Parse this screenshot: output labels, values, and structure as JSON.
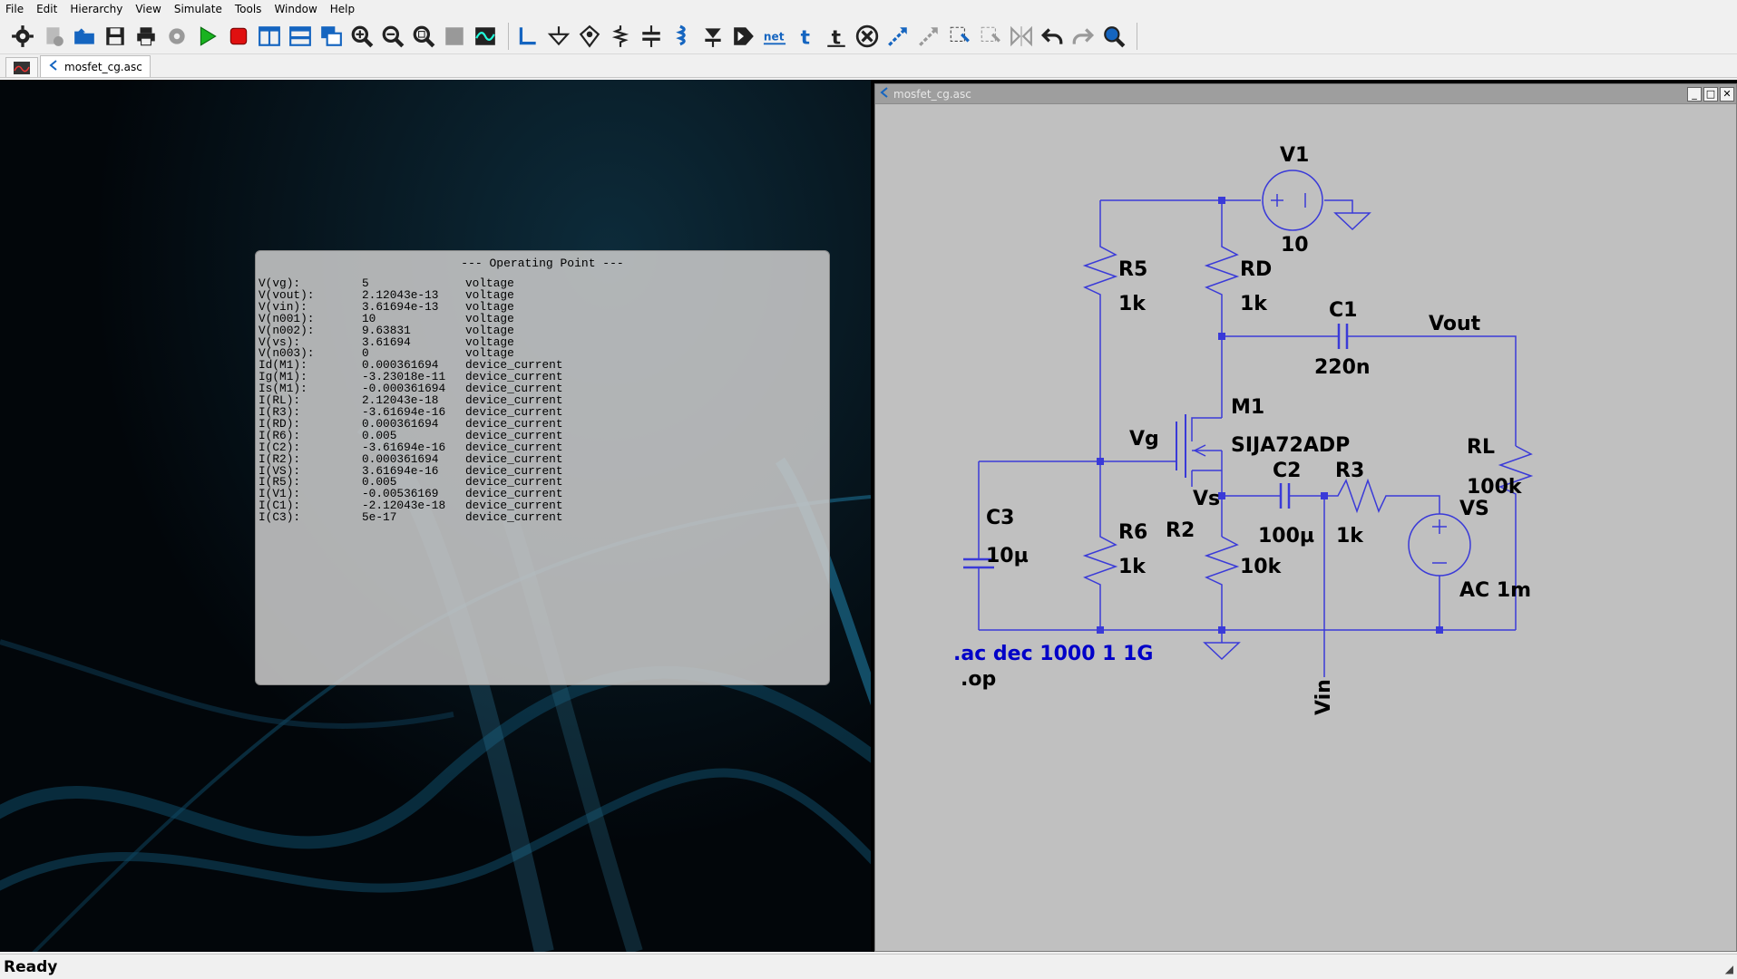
{
  "menu": [
    "File",
    "Edit",
    "Hierarchy",
    "View",
    "Simulate",
    "Tools",
    "Window",
    "Help"
  ],
  "tabs": [
    {
      "label": ""
    },
    {
      "label": "mosfet_cg.asc"
    }
  ],
  "op": {
    "title": "--- Operating Point ---",
    "rows": [
      {
        "name": "V(vg):",
        "value": "5",
        "type": "voltage"
      },
      {
        "name": "V(vout):",
        "value": "2.12043e-13",
        "type": "voltage"
      },
      {
        "name": "V(vin):",
        "value": "3.61694e-13",
        "type": "voltage"
      },
      {
        "name": "V(n001):",
        "value": "10",
        "type": "voltage"
      },
      {
        "name": "V(n002):",
        "value": "9.63831",
        "type": "voltage"
      },
      {
        "name": "V(vs):",
        "value": "3.61694",
        "type": "voltage"
      },
      {
        "name": "V(n003):",
        "value": "0",
        "type": "voltage"
      },
      {
        "name": "Id(M1):",
        "value": "0.000361694",
        "type": "device_current"
      },
      {
        "name": "Ig(M1):",
        "value": "-3.23018e-11",
        "type": "device_current"
      },
      {
        "name": "Is(M1):",
        "value": "-0.000361694",
        "type": "device_current"
      },
      {
        "name": "I(RL):",
        "value": "2.12043e-18",
        "type": "device_current"
      },
      {
        "name": "I(R3):",
        "value": "-3.61694e-16",
        "type": "device_current"
      },
      {
        "name": "I(RD):",
        "value": "0.000361694",
        "type": "device_current"
      },
      {
        "name": "I(R6):",
        "value": "0.005",
        "type": "device_current"
      },
      {
        "name": "I(C2):",
        "value": "-3.61694e-16",
        "type": "device_current"
      },
      {
        "name": "I(R2):",
        "value": "0.000361694",
        "type": "device_current"
      },
      {
        "name": "I(VS):",
        "value": "3.61694e-16",
        "type": "device_current"
      },
      {
        "name": "I(R5):",
        "value": "0.005",
        "type": "device_current"
      },
      {
        "name": "I(V1):",
        "value": "-0.00536169",
        "type": "device_current"
      },
      {
        "name": "I(C1):",
        "value": "-2.12043e-18",
        "type": "device_current"
      },
      {
        "name": "I(C3):",
        "value": "5e-17",
        "type": "device_current"
      }
    ]
  },
  "schematic": {
    "window_title": "mosfet_cg.asc",
    "win_min": "_",
    "win_max": "□",
    "win_close": "✕",
    "labels": {
      "v1_name": "V1",
      "v1_value": "10",
      "r5_name": "R5",
      "r5_value": "1k",
      "rd_name": "RD",
      "rd_value": "1k",
      "c1_name": "C1",
      "c1_value": "220n",
      "vout": "Vout",
      "m1_name": "M1",
      "m1_model": "SIJA72ADP",
      "vg": "Vg",
      "rl_name": "RL",
      "rl_value": "100k",
      "c2_name": "C2",
      "c2_value": "100µ",
      "r3_name": "R3",
      "r3_value": "1k",
      "vs_node": "Vs",
      "vs_name": "VS",
      "vs_value": "AC 1m",
      "c3_name": "C3",
      "c3_value": "10µ",
      "r6_name": "R6",
      "r6_value": "1k",
      "r2_name": "R2",
      "r2_value": "10k",
      "vin": "Vin",
      "directive_ac": ".ac dec 1000 1 1G",
      "directive_op": ".op"
    }
  },
  "status": "Ready",
  "colors": {
    "wire": "#3a3ad8",
    "directive": "#0000c8",
    "background": "#c0c0c0"
  }
}
